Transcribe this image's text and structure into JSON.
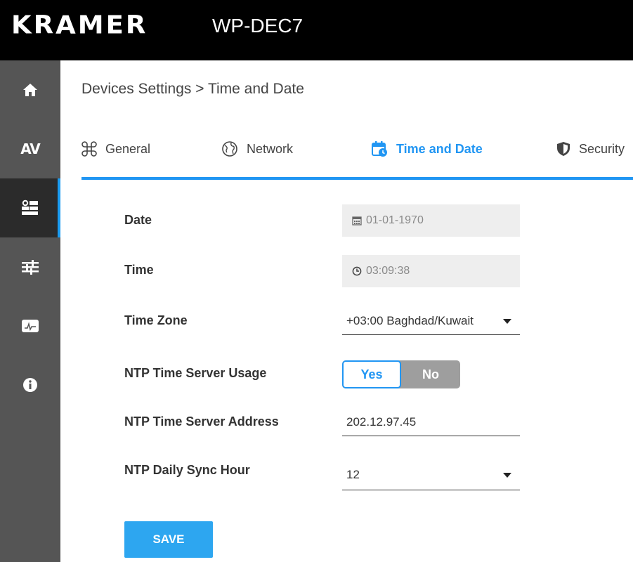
{
  "header": {
    "logo": "KRAMER",
    "device": "WP-DEC7"
  },
  "sidebar": {
    "items": [
      {
        "icon": "home-icon"
      },
      {
        "label": "AV",
        "icon": "av-icon"
      },
      {
        "icon": "device-settings-icon",
        "active": true
      },
      {
        "icon": "sliders-icon"
      },
      {
        "icon": "diagnostics-icon"
      },
      {
        "icon": "info-icon"
      }
    ],
    "accent": "#1a9bf0"
  },
  "breadcrumb": "Devices Settings > Time and Date",
  "tabs": [
    {
      "label": "General",
      "icon": "command-icon"
    },
    {
      "label": "Network",
      "icon": "globe-icon"
    },
    {
      "label": "Time and Date",
      "icon": "calendar-clock-icon",
      "active": true
    },
    {
      "label": "Security",
      "icon": "shield-icon"
    }
  ],
  "form": {
    "date": {
      "label": "Date",
      "value": "01-01-1970"
    },
    "time": {
      "label": "Time",
      "value": "03:09:38"
    },
    "timezone": {
      "label": "Time Zone",
      "value": "+03:00 Baghdad/Kuwait"
    },
    "ntp_usage": {
      "label": "NTP Time Server Usage",
      "yes": "Yes",
      "no": "No",
      "selected": "Yes"
    },
    "ntp_address": {
      "label": "NTP Time Server Address",
      "value": "202.12.97.45"
    },
    "ntp_sync_hour": {
      "label": "NTP Daily Sync Hour",
      "value": "12"
    }
  },
  "save_label": "SAVE",
  "colors": {
    "accent": "#2196f3",
    "header": "#000000",
    "sidebar": "#555555"
  }
}
